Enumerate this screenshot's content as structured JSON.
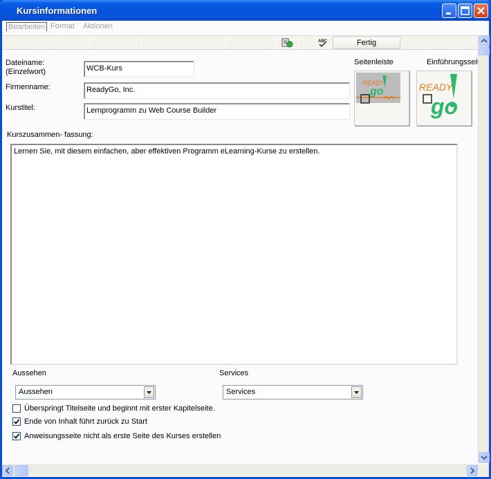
{
  "window": {
    "title": "Kursinformationen"
  },
  "menu": {
    "items": [
      "Bearbeiten",
      "Format",
      "Aktionen"
    ]
  },
  "toolbar": {
    "done_label": "Fertig",
    "spellcheck_icon": "spellcheck-icon",
    "save_icon": "save-page-icon"
  },
  "form": {
    "filename_label_1": "Dateiname:",
    "filename_label_2": "(Einzelwort)",
    "filename_value": "WCB-Kurs",
    "company_label": "Firmenname:",
    "company_value": "ReadyGo, Inc.",
    "title_label": "Kurstitel:",
    "title_value": "Lernprogramm zu Web Course Builder",
    "summary_label": "Kurszusammen- fassung:",
    "summary_value": "Lernen Sie, mit diesem einfachen, aber effektiven Programm eLearning-Kurse zu erstellen."
  },
  "images": {
    "sidebar_label": "Seitenleiste",
    "intro_label": "Einführungsseit",
    "logo_text_top": "READY",
    "logo_text_bottom": "go"
  },
  "appearance": {
    "label": "Aussehen",
    "selected": "Aussehen"
  },
  "services": {
    "label": "Services",
    "selected": "Services"
  },
  "options": [
    {
      "label": "Überspringt Titelseite und beginnt mit erster Kapitelseite.",
      "checked": false
    },
    {
      "label": "Ende von Inhalt führt zurück zu Start",
      "checked": true
    },
    {
      "label": "Anweisungsseite nicht als erste Seite des Kurses erstellen",
      "checked": true
    }
  ],
  "colors": {
    "title_bar": "#0553dd",
    "logo_orange": "#e87a1c",
    "logo_green": "#2fb86a"
  }
}
